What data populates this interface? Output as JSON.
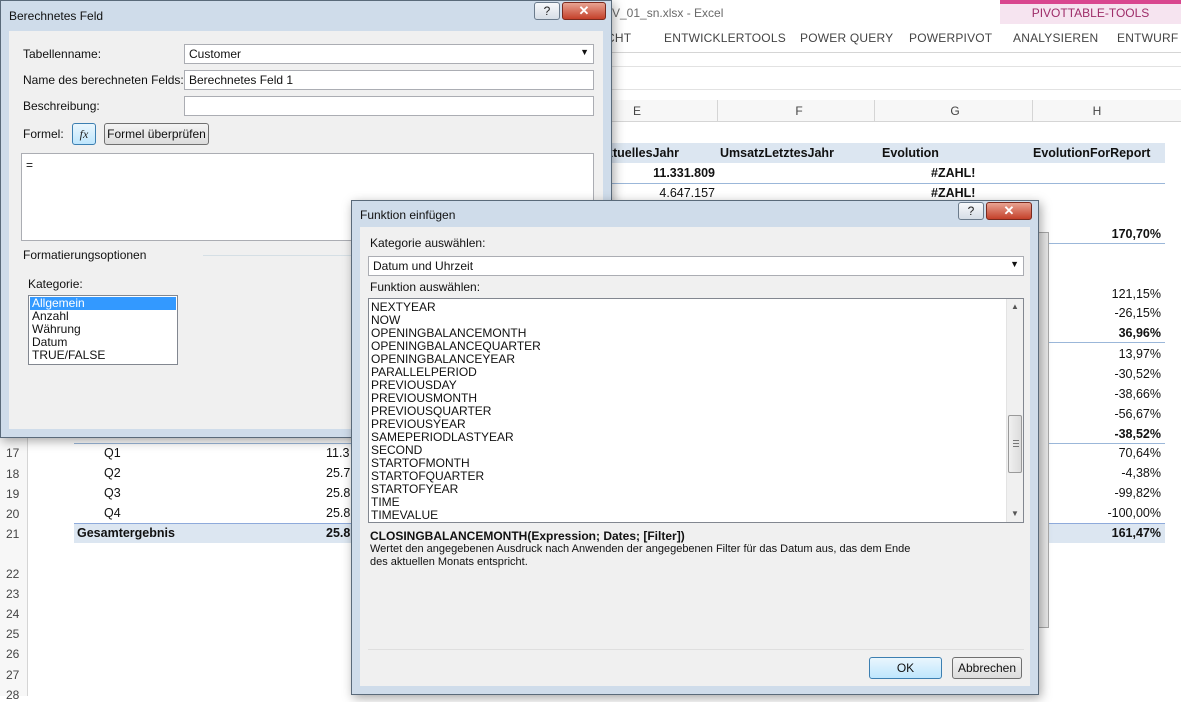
{
  "excel": {
    "file_title": "V_01_sn.xlsx - Excel",
    "pivot_tools_label": "PIVOTTABLE-TOOLS",
    "ribbon_tabs": [
      "CHT",
      "ENTWICKLERTOOLS",
      "POWER QUERY",
      "POWERPIVOT",
      "ANALYSIEREN",
      "ENTWURF"
    ],
    "column_headers": [
      "E",
      "F",
      "G",
      "H"
    ],
    "pivot_headers": [
      "ktuellesJahr",
      "UmsatzLetztesJahr",
      "Evolution",
      "EvolutionForReport"
    ],
    "top_rows": [
      {
        "e": "11.331.809",
        "g": "#ZAHL!"
      },
      {
        "e": "4.647.157",
        "g": "#ZAHL!"
      }
    ],
    "h_values": [
      "170,70%",
      "121,15%",
      "-26,15%",
      "36,96%",
      "13,97%",
      "-30,52%",
      "-38,66%",
      "-56,67%",
      "-38,52%",
      "70,64%",
      "-4,38%",
      "-99,82%",
      "-100,00%",
      "161,47%"
    ],
    "row_numbers": [
      "17",
      "18",
      "19",
      "20",
      "21",
      "22",
      "23",
      "24",
      "25",
      "26",
      "27",
      "28"
    ],
    "quarter_rows": [
      {
        "label": "Q1",
        "value": "11.3"
      },
      {
        "label": "Q2",
        "value": "25.7"
      },
      {
        "label": "Q3",
        "value": "25.8"
      },
      {
        "label": "Q4",
        "value": "25.8"
      }
    ],
    "total_label": "Gesamtergebnis",
    "total_value": "25.8"
  },
  "calc_field_dialog": {
    "title": "Berechnetes Feld",
    "help_label": "?",
    "close_label": "✕",
    "table_name_label": "Tabellenname:",
    "table_name_value": "Customer",
    "field_name_label": "Name des berechneten Felds:",
    "field_name_value": "Berechnetes Feld 1",
    "description_label": "Beschreibung:",
    "description_value": "",
    "formula_label": "Formel:",
    "fx_label": "fx",
    "check_formula_label": "Formel überprüfen",
    "formula_value": "=",
    "format_options_label": "Formatierungsoptionen",
    "category_label": "Kategorie:",
    "categories": [
      "Allgemein",
      "Anzahl",
      "Währung",
      "Datum",
      "TRUE/FALSE"
    ],
    "selected_category": "Allgemein"
  },
  "insert_function_dialog": {
    "title": "Funktion einfügen",
    "help_label": "?",
    "close_label": "✕",
    "category_select_label": "Kategorie auswählen:",
    "category_value": "Datum und Uhrzeit",
    "function_select_label": "Funktion auswählen:",
    "functions": [
      "NEXTYEAR",
      "NOW",
      "OPENINGBALANCEMONTH",
      "OPENINGBALANCEQUARTER",
      "OPENINGBALANCEYEAR",
      "PARALLELPERIOD",
      "PREVIOUSDAY",
      "PREVIOUSMONTH",
      "PREVIOUSQUARTER",
      "PREVIOUSYEAR",
      "SAMEPERIODLASTYEAR",
      "SECOND",
      "STARTOFMONTH",
      "STARTOFQUARTER",
      "STARTOFYEAR",
      "TIME",
      "TIMEVALUE"
    ],
    "syntax": "CLOSINGBALANCEMONTH(Expression; Dates; [Filter])",
    "description_line1": "Wertet den angegebenen Ausdruck nach Anwenden der angegebenen Filter für das Datum aus, das dem Ende",
    "description_line2": "des aktuellen Monats entspricht.",
    "ok_label": "OK",
    "cancel_label": "Abbrechen"
  }
}
